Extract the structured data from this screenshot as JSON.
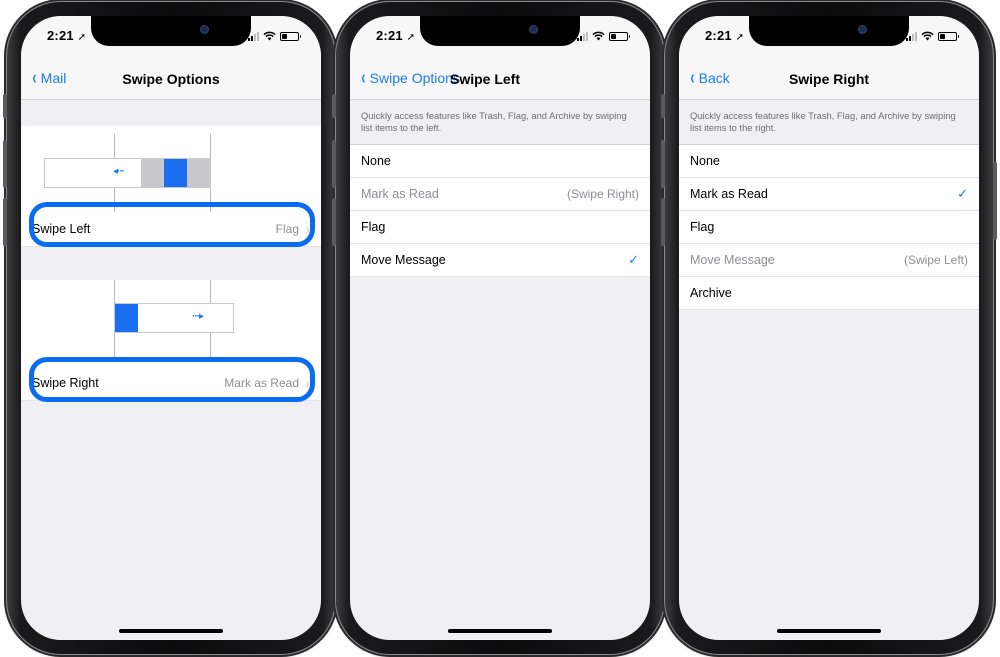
{
  "status": {
    "time": "2:21",
    "location_glyph": "➚"
  },
  "colors": {
    "accent": "#1a7cf2",
    "highlight": "#0a6cf0",
    "gray_block": "#c7c7cc"
  },
  "screen1": {
    "back_label": "Mail",
    "title": "Swipe Options",
    "swipe_left": {
      "label": "Swipe Left",
      "value": "Flag"
    },
    "swipe_right": {
      "label": "Swipe Right",
      "value": "Mark as Read"
    }
  },
  "screen2": {
    "back_label": "Swipe Options",
    "title": "Swipe Left",
    "description": "Quickly access features like Trash, Flag, and Archive by swiping list items to the left.",
    "options": [
      {
        "label": "None",
        "note": "",
        "checked": false,
        "disabled": false
      },
      {
        "label": "Mark as Read",
        "note": "(Swipe Right)",
        "checked": false,
        "disabled": true
      },
      {
        "label": "Flag",
        "note": "",
        "checked": false,
        "disabled": false
      },
      {
        "label": "Move Message",
        "note": "",
        "checked": true,
        "disabled": false
      }
    ]
  },
  "screen3": {
    "back_label": "Back",
    "title": "Swipe Right",
    "description": "Quickly access features like Trash, Flag, and Archive by swiping list items to the right.",
    "options": [
      {
        "label": "None",
        "note": "",
        "checked": false,
        "disabled": false
      },
      {
        "label": "Mark as Read",
        "note": "",
        "checked": true,
        "disabled": false
      },
      {
        "label": "Flag",
        "note": "",
        "checked": false,
        "disabled": false
      },
      {
        "label": "Move Message",
        "note": "(Swipe Left)",
        "checked": false,
        "disabled": true
      },
      {
        "label": "Archive",
        "note": "",
        "checked": false,
        "disabled": false
      }
    ]
  },
  "glyphs": {
    "checkmark": "✓",
    "disclosure": "›",
    "back_chevron": "‹"
  }
}
